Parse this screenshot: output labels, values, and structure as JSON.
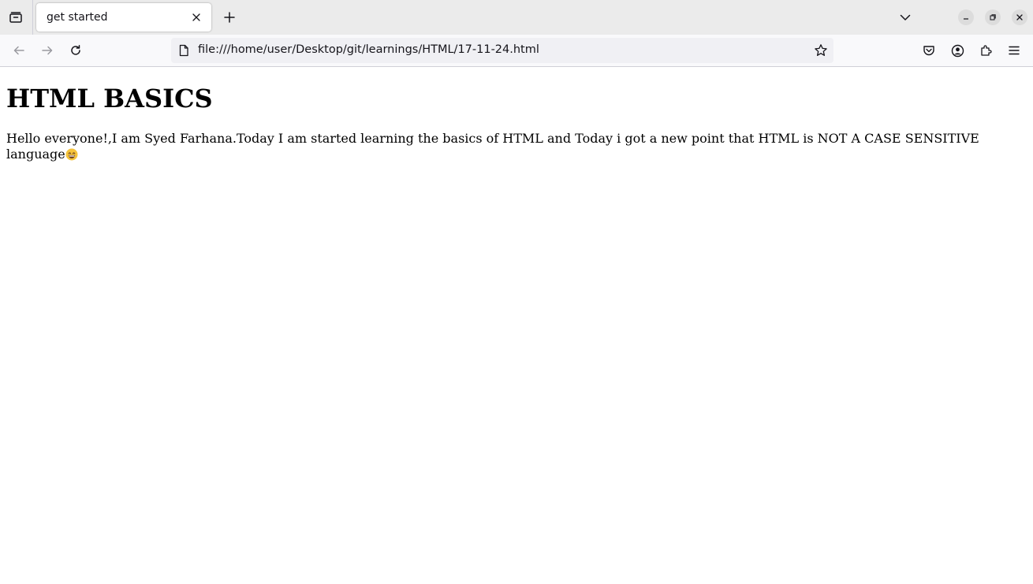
{
  "browser": {
    "tab": {
      "title": "get started"
    },
    "address_bar": {
      "url": "file:///home/user/Desktop/git/learnings/HTML/17-11-24.html"
    },
    "icons": {
      "tab_overview": "tab-overview-icon",
      "tab_close": "close-icon",
      "new_tab": "plus-icon",
      "tab_list": "chevron-down-icon",
      "minimize": "minimize-icon",
      "restore": "restore-icon",
      "close_window": "close-icon",
      "back": "arrow-left-icon",
      "forward": "arrow-right-icon",
      "reload": "reload-icon",
      "page_info": "page-icon",
      "bookmark": "star-icon",
      "pocket": "pocket-icon",
      "account": "account-icon",
      "extensions": "puzzle-icon",
      "menu": "hamburger-menu-icon"
    }
  },
  "page": {
    "heading": "HTML BASICS",
    "paragraph": "Hello everyone!,I am Syed Farhana.Today I am started learning the basics of HTML and Today i got a new point that HTML is NOT A CASE SENSITIVE language",
    "emoji_icon": "grinning-face-emoji"
  }
}
